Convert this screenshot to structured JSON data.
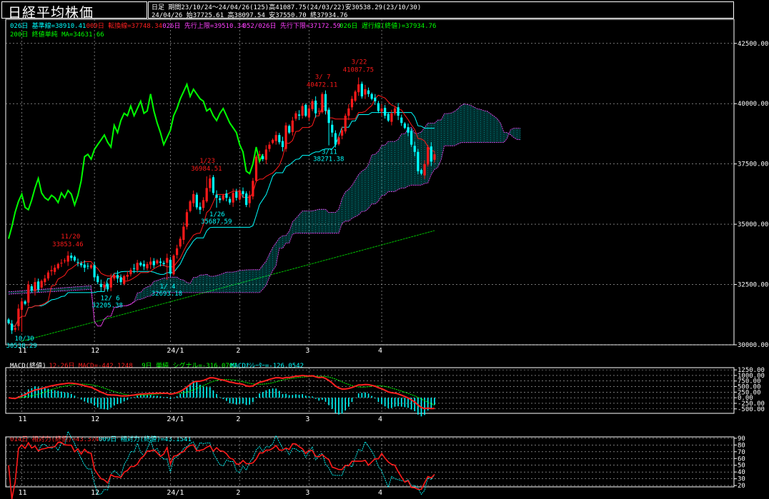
{
  "header": {
    "title": "日経平均株価",
    "line1": "日足  期間23/10/24～24/04/26(125)高41087.75(24/03/22)安30538.29(23/10/30)",
    "line2": "24/04/26      始37725.61 高38097.54 安37550.70 終37934.76"
  },
  "main_legend": {
    "row1": [
      {
        "text": "026日 基準線=38910.41",
        "color": "#00ffff"
      },
      {
        "text": "009日 転換線=37748.34",
        "color": "#ff2020"
      },
      {
        "text": "026日 先行上限=39510.34",
        "color": "#ff40ff"
      },
      {
        "text": "052/026日 先行下限=37172.59",
        "color": "#ff40ff"
      },
      {
        "text": "026日 遅行線(終値)=37934.76",
        "color": "#00ff00"
      }
    ],
    "row2": [
      {
        "text": "200日 終値単純 MA=34631.66",
        "color": "#00ff00"
      }
    ]
  },
  "macd_legend": [
    {
      "text": "MACD(終値)",
      "color": "#ffffff"
    },
    {
      "text": "12-26日 MACD=-442.1248",
      "color": "#ff2020"
    },
    {
      "text": "9日 単純 シグナル=-316.0701",
      "color": "#00ff00"
    },
    {
      "text": "MACDｵｼﾚｰﾀｰ=-126.0542",
      "color": "#00ffff"
    }
  ],
  "rsi_legend": [
    {
      "text": "014日 相対力(終値)=43.3747",
      "color": "#ff2020"
    },
    {
      "text": "009日 相対力(終値)=43.1541",
      "color": "#00ffff"
    }
  ],
  "colors": {
    "up": "#ff1a1a",
    "down": "#00ffff",
    "chikou": "#00ff00",
    "kumo": "#ff40ff",
    "macd": "#ff2020",
    "signal": "#00ff00"
  },
  "chart_data": [
    {
      "type": "candlestick",
      "ylim": [
        30000,
        43500
      ],
      "y_ticks": [
        "42500.00",
        "40000.00",
        "37500.00",
        "35000.00",
        "32500.00",
        "30000.00"
      ],
      "y_tick_values": [
        42500,
        40000,
        37500,
        35000,
        32500,
        30000
      ],
      "x_ticks": [
        {
          "label": "11",
          "day": 4
        },
        {
          "label": "12",
          "day": 26
        },
        {
          "label": "24/1",
          "day": 49
        },
        {
          "label": "2",
          "day": 70
        },
        {
          "label": "3",
          "day": 91
        },
        {
          "label": "4",
          "day": 113
        }
      ],
      "annotations": [
        {
          "date": "10/30",
          "value": "30538.29",
          "day": 4,
          "price": 30538.29,
          "kind": "low"
        },
        {
          "date": "11/20",
          "value": "33853.46",
          "day": 18,
          "price": 33853.46,
          "kind": "high"
        },
        {
          "date": "12/ 6",
          "value": "32205.38",
          "day": 30,
          "price": 32205.38,
          "kind": "low"
        },
        {
          "date": "1/ 4",
          "value": "32693.18",
          "day": 48,
          "price": 32693.18,
          "kind": "low"
        },
        {
          "date": "1/23",
          "value": "36984.51",
          "day": 60,
          "price": 36984.51,
          "kind": "high"
        },
        {
          "date": "1/26",
          "value": "35687.59",
          "day": 63,
          "price": 35687.59,
          "kind": "low"
        },
        {
          "date": "3/ 7",
          "value": "40472.11",
          "day": 95,
          "price": 40472.11,
          "kind": "high"
        },
        {
          "date": "3/11",
          "value": "38271.38",
          "day": 97,
          "price": 38271.38,
          "kind": "low"
        },
        {
          "date": "3/22",
          "value": "41087.75",
          "day": 106,
          "price": 41087.75,
          "kind": "high"
        }
      ],
      "close": [
        30900,
        30600,
        30700,
        31500,
        31800,
        31700,
        32500,
        32250,
        32600,
        32300,
        32650,
        32750,
        33000,
        33100,
        33200,
        33350,
        33400,
        33500,
        33700,
        33600,
        33500,
        33400,
        33300,
        33200,
        33250,
        33300,
        32800,
        32600,
        32400,
        32500,
        32300,
        32800,
        32900,
        32750,
        32600,
        32850,
        32900,
        33100,
        33150,
        33400,
        33300,
        33250,
        33350,
        33450,
        33300,
        33500,
        33400,
        33350,
        33600,
        32950,
        33700,
        34000,
        34400,
        34900,
        35500,
        35950,
        36250,
        35700,
        35600,
        36000,
        36500,
        36900,
        36300,
        36100,
        36000,
        36200,
        36100,
        35900,
        36300,
        36100,
        36400,
        36250,
        35800,
        36200,
        36800,
        37800,
        37900,
        37700,
        38100,
        38300,
        38500,
        38700,
        38400,
        38200,
        39100,
        38800,
        39300,
        39600,
        39500,
        39900,
        39500,
        39800,
        40100,
        39600,
        39700,
        40400,
        39700,
        39200,
        38800,
        38300,
        38600,
        38900,
        39500,
        39800,
        40200,
        40500,
        40800,
        40300,
        40600,
        40400,
        40200,
        40100,
        39700,
        39800,
        39500,
        39300,
        39600,
        39800,
        39500,
        39200,
        39000,
        38800,
        38300,
        38000,
        37200,
        37100,
        37500,
        38200,
        37600,
        37900
      ]
    },
    {
      "type": "line",
      "title": "MACD",
      "ylim": [
        -700,
        1350
      ],
      "y_ticks": [
        "1250.00",
        "1000.00",
        "750.00",
        "500.00",
        "250.00",
        "0.00",
        "-250.00",
        "-500.00"
      ],
      "y_tick_values": [
        1250,
        1000,
        750,
        500,
        250,
        0,
        -250,
        -500
      ]
    },
    {
      "type": "line",
      "title": "RSI",
      "ylim": [
        18,
        92
      ],
      "y_ticks": [
        "90",
        "80",
        "70",
        "60",
        "50",
        "40",
        "30",
        "20"
      ],
      "y_tick_values": [
        90,
        80,
        70,
        60,
        50,
        40,
        30,
        20
      ]
    }
  ]
}
